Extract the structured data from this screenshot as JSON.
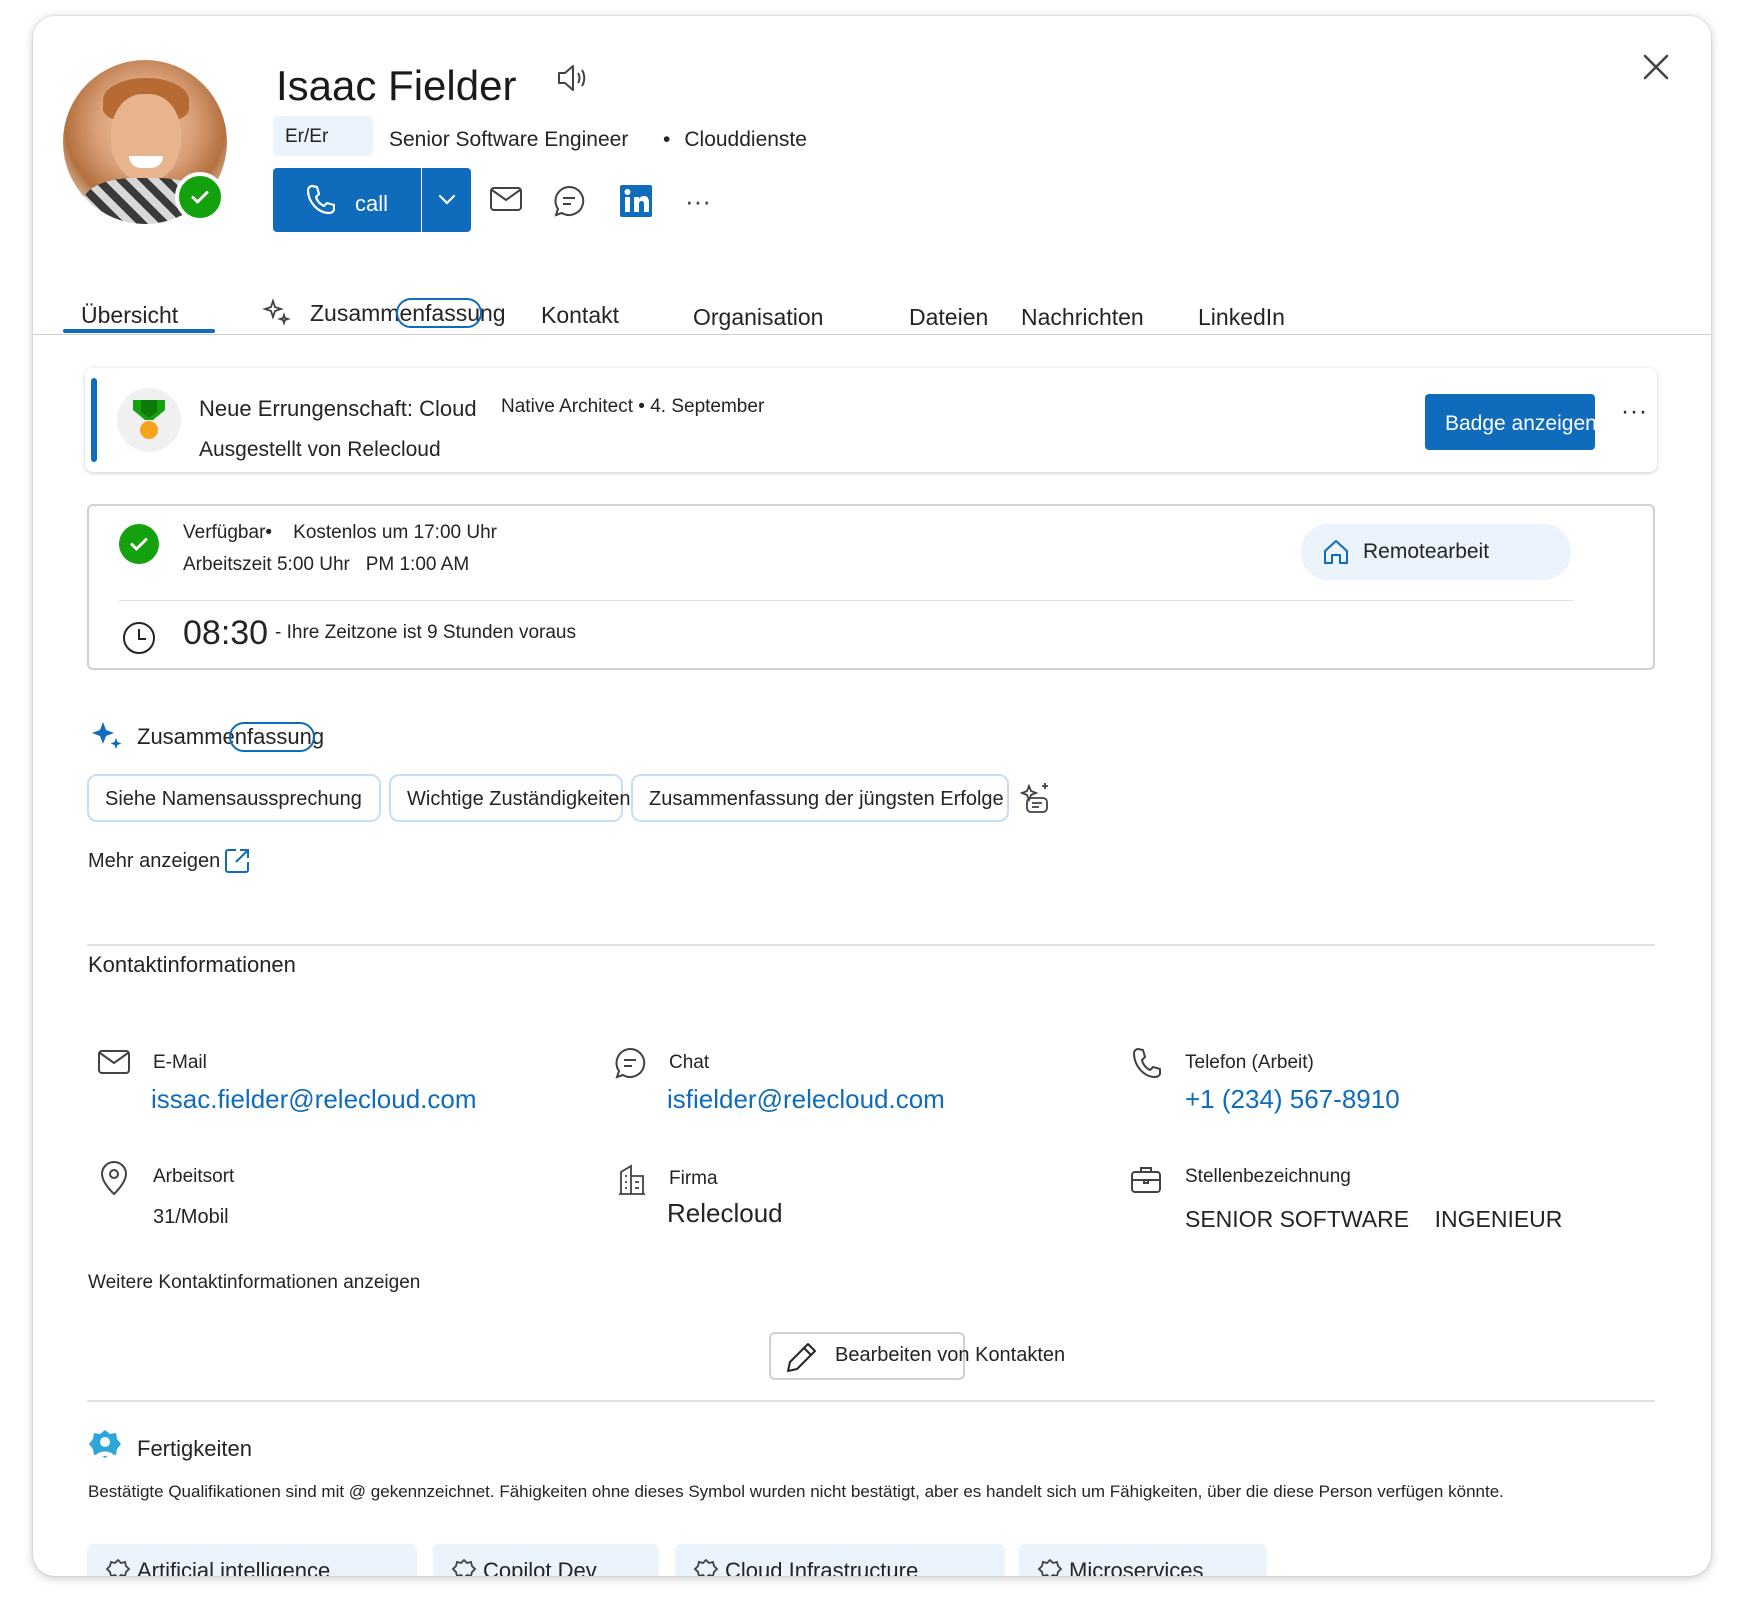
{
  "person": {
    "name": "Isaac Fielder",
    "pronouns": "Er/Er",
    "job_title": "Senior Software Engineer",
    "department": "Clouddienste"
  },
  "actions": {
    "call_label": "call"
  },
  "tabs": [
    {
      "label": "Übersicht"
    },
    {
      "label": "Zusammenfassung"
    },
    {
      "label": "Kontakt"
    },
    {
      "label": "Organisation"
    },
    {
      "label": "Dateien"
    },
    {
      "label": "Nachrichten"
    },
    {
      "label": "LinkedIn"
    }
  ],
  "achievement": {
    "title": "Neue Errungenschaft: Cloud",
    "meta": "Native Architect • 4. September",
    "issuer": "Ausgestellt von Relecloud",
    "button": "Badge anzeigen",
    "more": "···"
  },
  "availability": {
    "line1": "Verfügbar•    Kostenlos um 17:00 Uhr",
    "line2": "Arbeitszeit 5:00 Uhr   PM 1:00 AM",
    "location_chip": "Remotearbeit",
    "local_time": "08:30",
    "timezone_note": "- Ihre Zeitzone ist 9 Stunden voraus"
  },
  "summary": {
    "title": "Zusammenfassung",
    "chips": [
      "Siehe Namensaussprechung",
      "Wichtige Zuständigkeiten",
      "Zusammenfassung der jüngsten Erfolge"
    ],
    "more_link": "Mehr anzeigen"
  },
  "contact": {
    "title": "Kontaktinformationen",
    "email_label": "E-Mail",
    "email": "issac.fielder@relecloud.com",
    "chat_label": "Chat",
    "chat": "isfielder@relecloud.com",
    "phone_label": "Telefon (Arbeit)",
    "phone": "+1 (234) 567-8910",
    "location_label": "Arbeitsort",
    "location": "31/Mobil",
    "company_label": "Firma",
    "company": "Relecloud",
    "jobtitle_label": "Stellenbezeichnung",
    "jobtitle": "SENIOR SOFTWARE    INGENIEUR",
    "more": "Weitere Kontaktinformationen anzeigen",
    "edit": "Bearbeiten von Kontakten"
  },
  "skills": {
    "title": "Fertigkeiten",
    "description": "Bestätigte Qualifikationen sind mit @ gekennzeichnet. Fähigkeiten ohne dieses Symbol wurden nicht bestätigt, aber es handelt sich um Fähigkeiten, über die diese Person verfügen könnte.",
    "items": [
      "Artificial intelligence",
      "Copilot Dev",
      "Cloud Infrastructure",
      "Microservices"
    ]
  },
  "colors": {
    "accent": "#0f6cbd",
    "presence": "#13a10e",
    "chip_bg": "#ebf3fc"
  }
}
